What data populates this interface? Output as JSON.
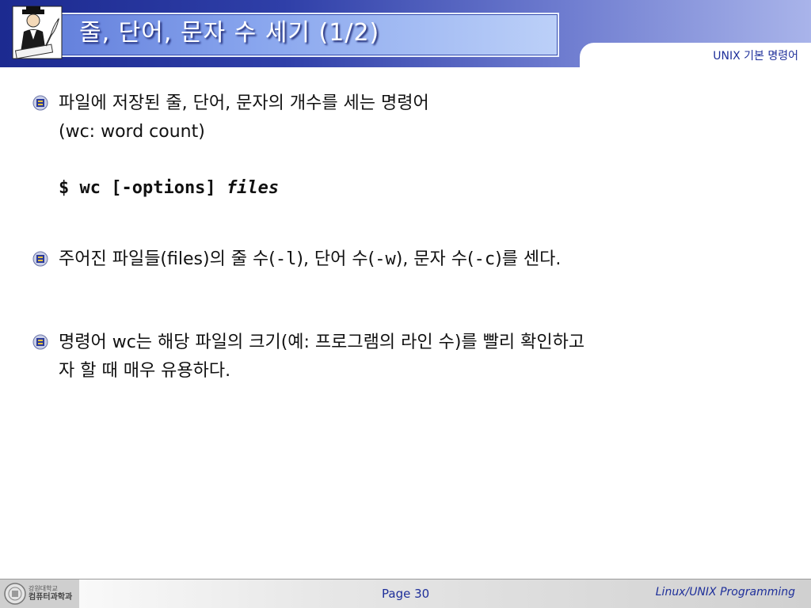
{
  "header": {
    "title": "줄, 단어, 문자 수 세기 (1/2)",
    "subject": "UNIX 기본 명령어"
  },
  "bullets": [
    {
      "line1": "파일에 저장된 줄, 단어, 문자의 개수를 세는 명령어",
      "line2": "(wc: word count)"
    },
    {
      "part1": "주어진 파일들(files)의 줄 수(",
      "opt_l": "-l",
      "part2": "), 단어 수(",
      "opt_w": "-w",
      "part3": "), 문자 수(",
      "opt_c": "-c",
      "part4": ")를 센다."
    },
    {
      "line1": "명령어 wc는 해당 파일의 크기(예: 프로그램의 라인 수)를 빨리 확인하고",
      "line2": "자 할 때 매우 유용하다."
    }
  ],
  "command": {
    "prefix": "$ wc [-options]",
    "arg": "files"
  },
  "footer": {
    "org_line1": "강원대학교",
    "org_line2": "컴퓨터과학과",
    "page": "Page 30",
    "course": "Linux/UNIX Programming"
  },
  "colors": {
    "header_dark": "#1c2a90",
    "accent_text": "#1e2f9a",
    "title_panel": "#89a6ee"
  },
  "icons": {
    "logo": "man-writing-with-quill-icon",
    "bullet": "emblem-bullet-icon",
    "footer": "university-seal-icon"
  }
}
